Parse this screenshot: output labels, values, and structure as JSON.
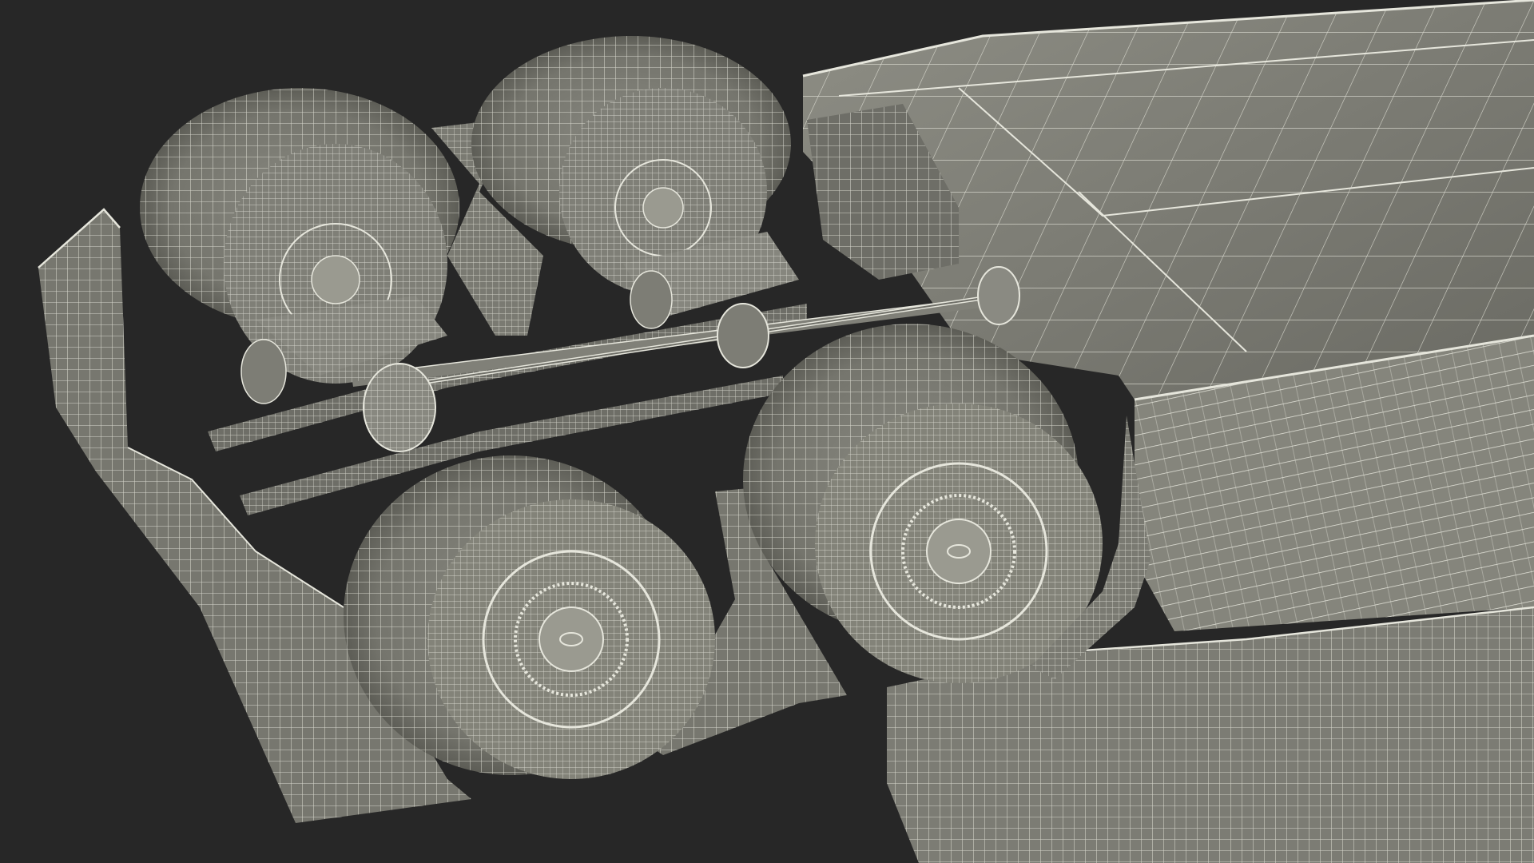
{
  "scene": {
    "subject": "truck-chassis-wireframe-render",
    "colors": {
      "background": "#272727",
      "surface": "#7a7a72",
      "surface_light": "#8e8e85",
      "surface_dark": "#5f5f58",
      "wire": "#e6e6dc"
    }
  }
}
